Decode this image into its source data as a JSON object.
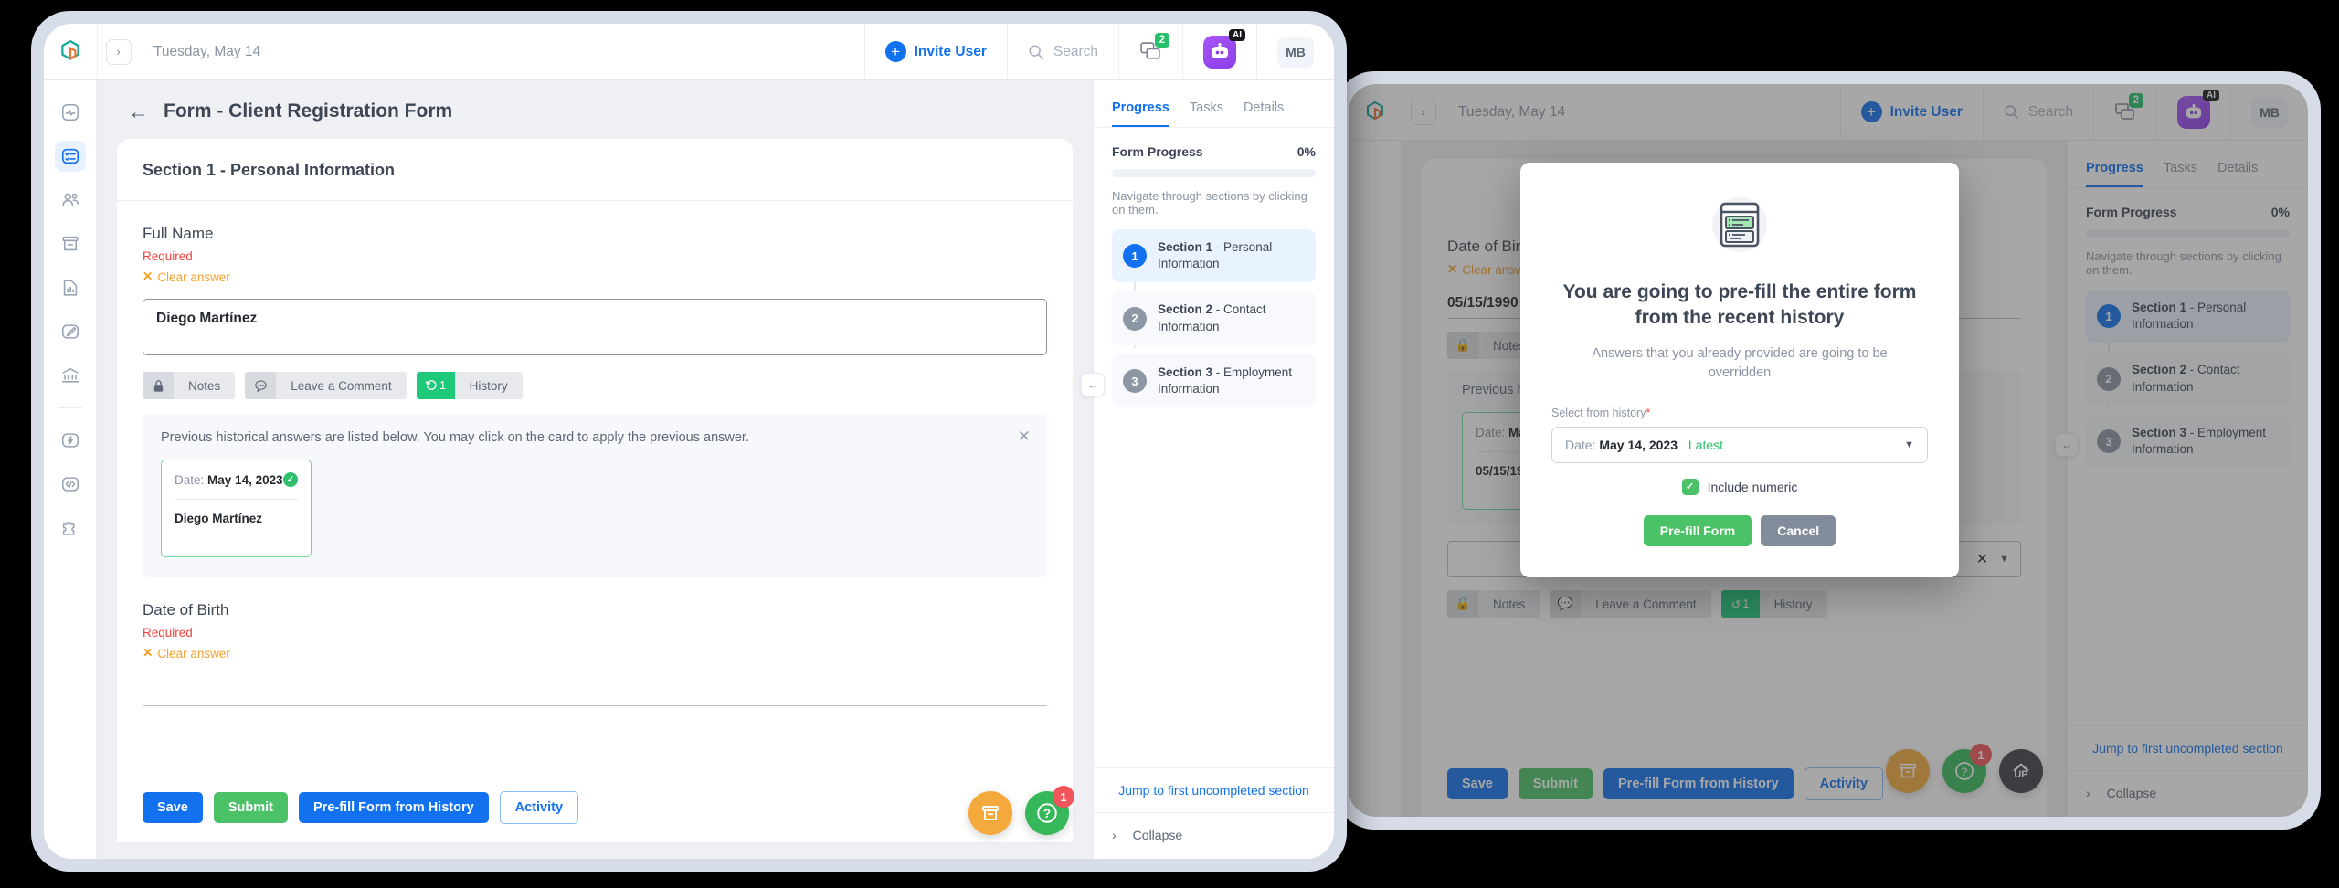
{
  "topbar": {
    "logo_icon": "app-logo-icon",
    "next_icon": "chevron-right-icon",
    "date": "Tuesday, May 14",
    "invite_label": "Invite User",
    "search_placeholder": "Search",
    "chat_icon": "chat-bubbles-icon",
    "chat_badge": "2",
    "ai_icon": "ai-assistant-icon",
    "ai_tag": "AI",
    "avatar_initials": "MB"
  },
  "rail": {
    "items": [
      {
        "icon": "activity-pulse-icon",
        "name": "dashboard"
      },
      {
        "icon": "checklist-icon",
        "name": "forms"
      },
      {
        "icon": "people-icon",
        "name": "clients"
      },
      {
        "icon": "archive-box-icon",
        "name": "archive"
      },
      {
        "icon": "file-chart-icon",
        "name": "reports"
      },
      {
        "icon": "signature-pen-icon",
        "name": "signatures"
      },
      {
        "icon": "bank-icon",
        "name": "billing"
      },
      {
        "icon": "automation-bolt-icon",
        "name": "automations"
      },
      {
        "icon": "code-brackets-icon",
        "name": "developer"
      },
      {
        "icon": "puzzle-piece-icon",
        "name": "integrations"
      }
    ]
  },
  "form": {
    "back_icon": "back-arrow-icon",
    "title": "Form - Client Registration Form",
    "section_title": "Section 1 - Personal Information",
    "questions": [
      {
        "label": "Full Name",
        "required_text": "Required",
        "clear_text": "Clear answer",
        "answer": "Diego Martínez"
      },
      {
        "label": "Date of Birth",
        "required_text": "Required",
        "clear_text": "Clear answer",
        "answer": ""
      }
    ],
    "meta_buttons": {
      "notes": "Notes",
      "notes_icon": "lock-icon",
      "comment": "Leave a Comment",
      "comment_icon": "comment-bubble-icon",
      "history": "History",
      "history_icon": "history-clock-icon",
      "history_count": "1"
    },
    "history_panel": {
      "note": "Previous historical answers are listed below. You may click on the card to apply the previous answer.",
      "close_icon": "close-icon",
      "card": {
        "date_label": "Date:",
        "date_value": "May 14, 2023",
        "check_icon": "check-circle-icon",
        "value": "Diego Martínez"
      }
    },
    "actions": {
      "save": "Save",
      "submit": "Submit",
      "prefill": "Pre-fill Form from History",
      "activity": "Activity"
    }
  },
  "fabs": {
    "archive_icon": "archive-box-icon",
    "help_icon": "help-question-icon",
    "help_badge": "1",
    "scroll_up_icon": "chevron-up-icon",
    "scroll_up_label": "UP"
  },
  "sidepanel": {
    "tabs": [
      {
        "label": "Progress",
        "active": true
      },
      {
        "label": "Tasks",
        "active": false
      },
      {
        "label": "Details",
        "active": false
      }
    ],
    "progress_label": "Form Progress",
    "progress_value": "0%",
    "hint": "Navigate through sections by clicking on them.",
    "sections": [
      {
        "num": "1",
        "strong": "Section 1",
        "rest": " - Personal Information",
        "active": true
      },
      {
        "num": "2",
        "strong": "Section 2",
        "rest": " - Contact Information",
        "active": false
      },
      {
        "num": "3",
        "strong": "Section 3",
        "rest": " - Employment Information",
        "active": false
      }
    ],
    "jump_label": "Jump to first uncompleted section",
    "collapse_label": "Collapse",
    "collapse_icon": "chevron-right-icon",
    "resize_icon": "horizontal-resize-icon"
  },
  "back_window": {
    "question_label": "Date of Birth",
    "clear_text": "Clear answer",
    "answer": "05/15/1990",
    "history_note": "Previous historical answers are listed below.",
    "history_date_label": "Date:",
    "history_date_value": "May 14, 2023",
    "history_value": "05/15/1990",
    "dropdown_clear_icon": "clear-x-icon",
    "dropdown_caret_icon": "caret-down-icon"
  },
  "modal": {
    "illustration_icon": "prefill-form-illustration",
    "title": "You are going to pre-fill the entire form from the recent history",
    "subtitle": "Answers that you already provided are going to be overridden",
    "field_label": "Select from history",
    "required_marker": "*",
    "select_prefix": "Date:",
    "select_value": "May 14, 2023",
    "select_tag": "Latest",
    "caret_icon": "caret-down-icon",
    "checkbox_label": "Include numeric",
    "checkbox_checked": true,
    "confirm_label": "Pre-fill Form",
    "cancel_label": "Cancel"
  }
}
